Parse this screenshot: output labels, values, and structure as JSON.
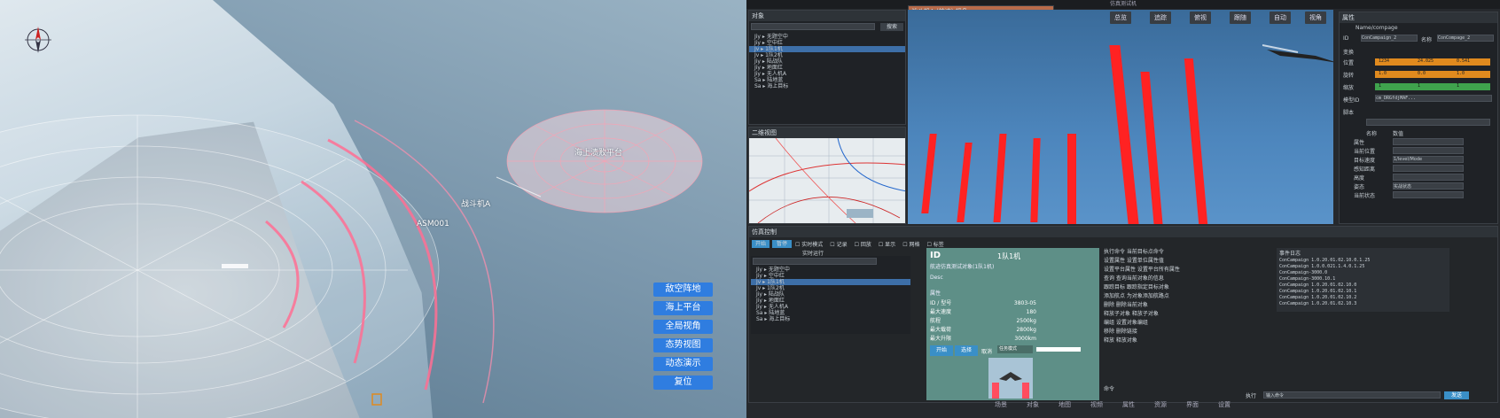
{
  "left_view": {
    "labels": {
      "platform": "海上溃败平台",
      "asm": "ASM001",
      "aircraft": "战斗机A"
    },
    "buttons": [
      "敌空阵地",
      "海上平台",
      "全局视角",
      "态势视图",
      "动态演示",
      "复位"
    ]
  },
  "tree_panel": {
    "title": "对象",
    "search_btn": "搜索",
    "items": [
      "Jiy ▸ 无题空中",
      "Jiy ▸ 空中红",
      "Jv ▸ 1队1机",
      "Jv ▸ 1队2机",
      "Jiy ▸ 陆战队",
      "Jiy ▸ 地面红",
      "Jiy ▸ 无人机A",
      "Sa ▸ 陆地蓝",
      "Sa ▸ 海上目标"
    ]
  },
  "map_panel": {
    "title": "二维视图"
  },
  "cockpit_panel": {
    "title": "战斗机A (航迹) 视角"
  },
  "main_window": {
    "title": "仿真测试机"
  },
  "toolbar": [
    "总览",
    "追踪",
    "俯视",
    "跟随",
    "自动",
    "视角"
  ],
  "properties": {
    "header": "属性",
    "subtitle": "Name/compage",
    "id_label": "ID",
    "id_value": "ConCampaign_2",
    "name_label": "名称",
    "name_value": "ConCompage_2",
    "transform_label": "变换",
    "pos_label": "位置",
    "rot_label": "旋转",
    "scale_label": "缩放",
    "pos_values": [
      "1234",
      "24.025",
      "0.541"
    ],
    "rot_values": [
      "1.0",
      "0.0",
      "1.0"
    ],
    "scale_values": [
      "1",
      "1",
      "1"
    ],
    "model_label": "模型ID",
    "model_value": "cm_DRGfdjMAF...",
    "section2": "脚本",
    "table_headers": [
      "名称",
      "数值"
    ],
    "rows": [
      "属性",
      "当前位置",
      "目标速度",
      "感知距离",
      "高度",
      "姿态",
      "当前状态"
    ],
    "row_values": [
      "",
      "",
      "1/level/Mode",
      "",
      "",
      "实战状态",
      ""
    ]
  },
  "console": {
    "title": "仿真控制",
    "tabs": [
      "开始",
      "暂停"
    ],
    "checks": [
      "实时模式",
      "记录",
      "回放",
      "显示",
      "网格",
      "标签"
    ],
    "status": "实时运行",
    "id_header": "ID",
    "id_name": "1队1机",
    "subtitle": "航迹仿真测试对象(1队1机)",
    "desc_label": "Desc",
    "attr_label": "属性",
    "fields": [
      {
        "k": "ID / 型号",
        "v": "3803-05"
      },
      {
        "k": "最大速度",
        "v": "180"
      },
      {
        "k": "航程",
        "v": "2500kg"
      },
      {
        "k": "最大载荷",
        "v": "2800kg"
      },
      {
        "k": "最大升限",
        "v": "3000km"
      }
    ],
    "btn_a": "开始",
    "btn_b": "选择",
    "btn_c": "取消",
    "mode_label": "任务模式",
    "cmds": [
      "执行命令 当前目标点命令",
      "设置属性 设置单位属性值",
      "设置平台属性 设置平台所有属性",
      "查询 查询当前对象的信息",
      "跟踪目标 跟踪指定目标对象",
      "添加航点 为对象添加航路点",
      "删除 删除当前对象",
      "释放子对象 释放子对象",
      "编组 设置对象编组",
      "移除 删除链接",
      "释放 释放对象"
    ],
    "log_title": "事件日志",
    "log": [
      "ConCampaign 1.0.20.01.02.10.0.1.25",
      "ConCampaign 1.0.0.021.1.4.0.1.25",
      "ConCampaign-3000.0",
      "ConCampaign-3000.10.1",
      "ConCampaign 1.0.20.01.02.10.0",
      "ConCampaign 1.0.20.01.02.10.1",
      "ConCampaign 1.0.20.01.02.10.2",
      "ConCampaign 1.0.20.01.02.10.3"
    ],
    "cmd_label": "命令",
    "run_label": "执行",
    "cmd_placeholder": "输入命令",
    "send": "发送"
  },
  "bottom_tabs": [
    "场景",
    "对象",
    "地图",
    "视频",
    "属性",
    "资源",
    "界面",
    "设置"
  ]
}
